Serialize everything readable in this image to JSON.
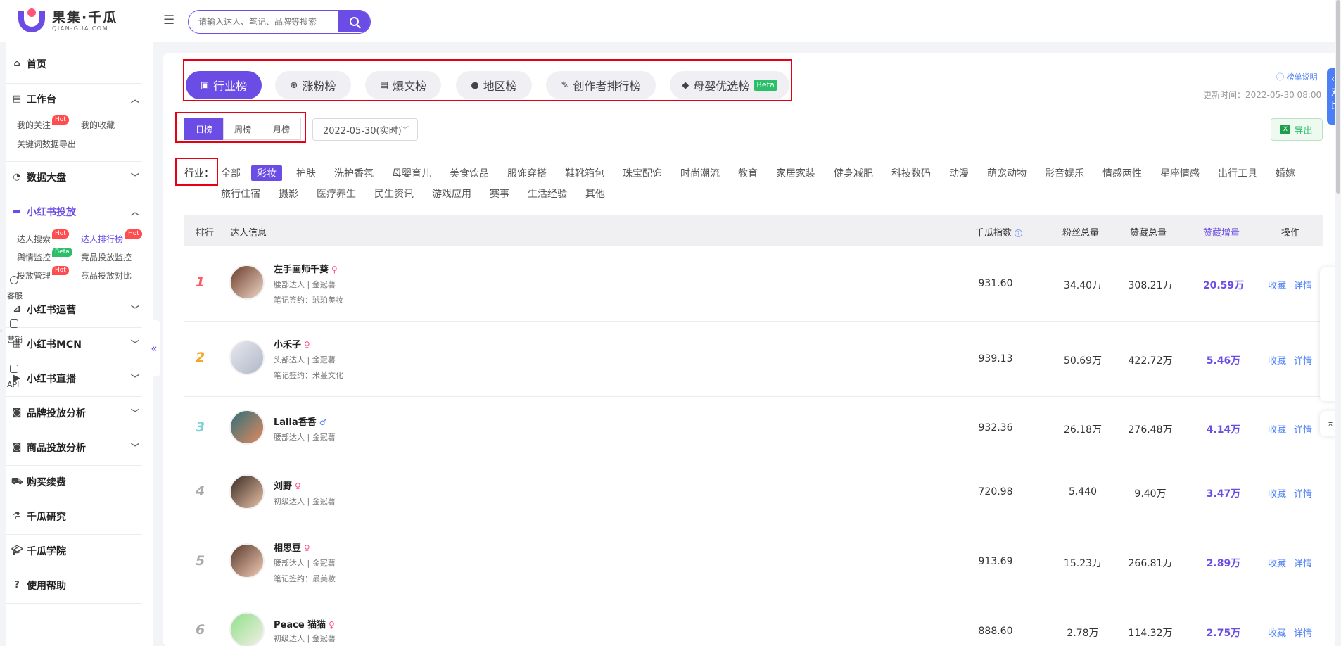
{
  "brand": {
    "name_cn": "果集·千瓜",
    "name_en": "QIAN-GUA.COM"
  },
  "search": {
    "placeholder": "请输入达人、笔记、品牌等搜索"
  },
  "sidebar": {
    "home": "首页",
    "workbench": "工作台",
    "workbench_items": [
      "我的关注",
      "我的收藏",
      "关键词数据导出"
    ],
    "data_dashboard": "数据大盘",
    "xhs_ads": "小红书投放",
    "xhs_ads_items": [
      "达人搜索",
      "达人排行榜",
      "舆情监控",
      "竞品投放监控",
      "投放管理",
      "竞品投放对比"
    ],
    "xhs_ops": "小红书运营",
    "xhs_mcn": "小红书MCN",
    "xhs_live": "小红书直播",
    "brand_analysis": "品牌投放分析",
    "product_analysis": "商品投放分析",
    "purchase": "购买续费",
    "research": "千瓜研究",
    "academy": "千瓜学院",
    "help": "使用帮助",
    "tags": {
      "hot": "Hot",
      "beta": "Beta"
    }
  },
  "rank_tabs": [
    "行业榜",
    "涨粉榜",
    "爆文榜",
    "地区榜",
    "创作者排行榜",
    "母婴优选榜"
  ],
  "rank_tab_beta": "Beta",
  "rule_link": "榜单说明",
  "update_time": "更新时间：2022-05-30 08:00",
  "export_label": "导出",
  "periods": [
    "日榜",
    "周榜",
    "月榜"
  ],
  "date_value": "2022-05-30(实时)",
  "industry_label": "行业：",
  "industries": [
    "全部",
    "彩妆",
    "护肤",
    "洗护香氛",
    "母婴育儿",
    "美食饮品",
    "服饰穿搭",
    "鞋靴箱包",
    "珠宝配饰",
    "时尚潮流",
    "教育",
    "家居家装",
    "健身减肥",
    "科技数码",
    "动漫",
    "萌宠动物",
    "影音娱乐",
    "情感两性",
    "星座情感",
    "出行工具",
    "婚嫁",
    "旅行住宿",
    "摄影",
    "医疗养生",
    "民生资讯",
    "游戏应用",
    "赛事",
    "生活经验",
    "其他"
  ],
  "table": {
    "headers": {
      "rank": "排行",
      "info": "达人信息",
      "index": "千瓜指数",
      "fans": "粉丝总量",
      "likes": "赞藏总量",
      "growth": "赞藏增量",
      "ops": "操作"
    },
    "actions": {
      "fav": "收藏",
      "detail": "详情"
    },
    "rows": [
      {
        "rank": "1",
        "name": "左手画师千葵",
        "sex": "♀",
        "level": "腰部达人 | 金冠薯",
        "sign": "笔记签约：琥珀美妆",
        "index": "931.60",
        "fans": "34.40万",
        "likes": "308.21万",
        "growth": "20.59万"
      },
      {
        "rank": "2",
        "name": "小禾子",
        "sex": "♀",
        "level": "头部达人 | 金冠薯",
        "sign": "笔记签约：米蔓文化",
        "index": "939.13",
        "fans": "50.69万",
        "likes": "422.72万",
        "growth": "5.46万"
      },
      {
        "rank": "3",
        "name": "Lalla香香",
        "sex": "♂",
        "level": "腰部达人 | 金冠薯",
        "sign": "",
        "index": "932.36",
        "fans": "26.18万",
        "likes": "276.48万",
        "growth": "4.14万"
      },
      {
        "rank": "4",
        "name": "刘野",
        "sex": "♀",
        "level": "初级达人 | 金冠薯",
        "sign": "",
        "index": "720.98",
        "fans": "5,440",
        "likes": "9.40万",
        "growth": "3.47万"
      },
      {
        "rank": "5",
        "name": "相思豆",
        "sex": "♀",
        "level": "腰部达人 | 金冠薯",
        "sign": "笔记签约：最美妆",
        "index": "913.69",
        "fans": "15.23万",
        "likes": "266.81万",
        "growth": "2.89万"
      },
      {
        "rank": "6",
        "name": "Peace 猫猫",
        "sex": "♀",
        "level": "初级达人 | 金冠薯",
        "sign": "",
        "index": "888.60",
        "fans": "2.78万",
        "likes": "114.32万",
        "growth": "2.75万"
      }
    ]
  },
  "right_panel": {
    "blue_tab": "对比",
    "items": [
      "客服",
      "营销",
      "API"
    ]
  },
  "colors": {
    "accent": "#6b4de6",
    "highlight": "#e60012",
    "link": "#4c7ff5",
    "hot": "#ff4d4f",
    "beta": "#2bbf6a"
  }
}
